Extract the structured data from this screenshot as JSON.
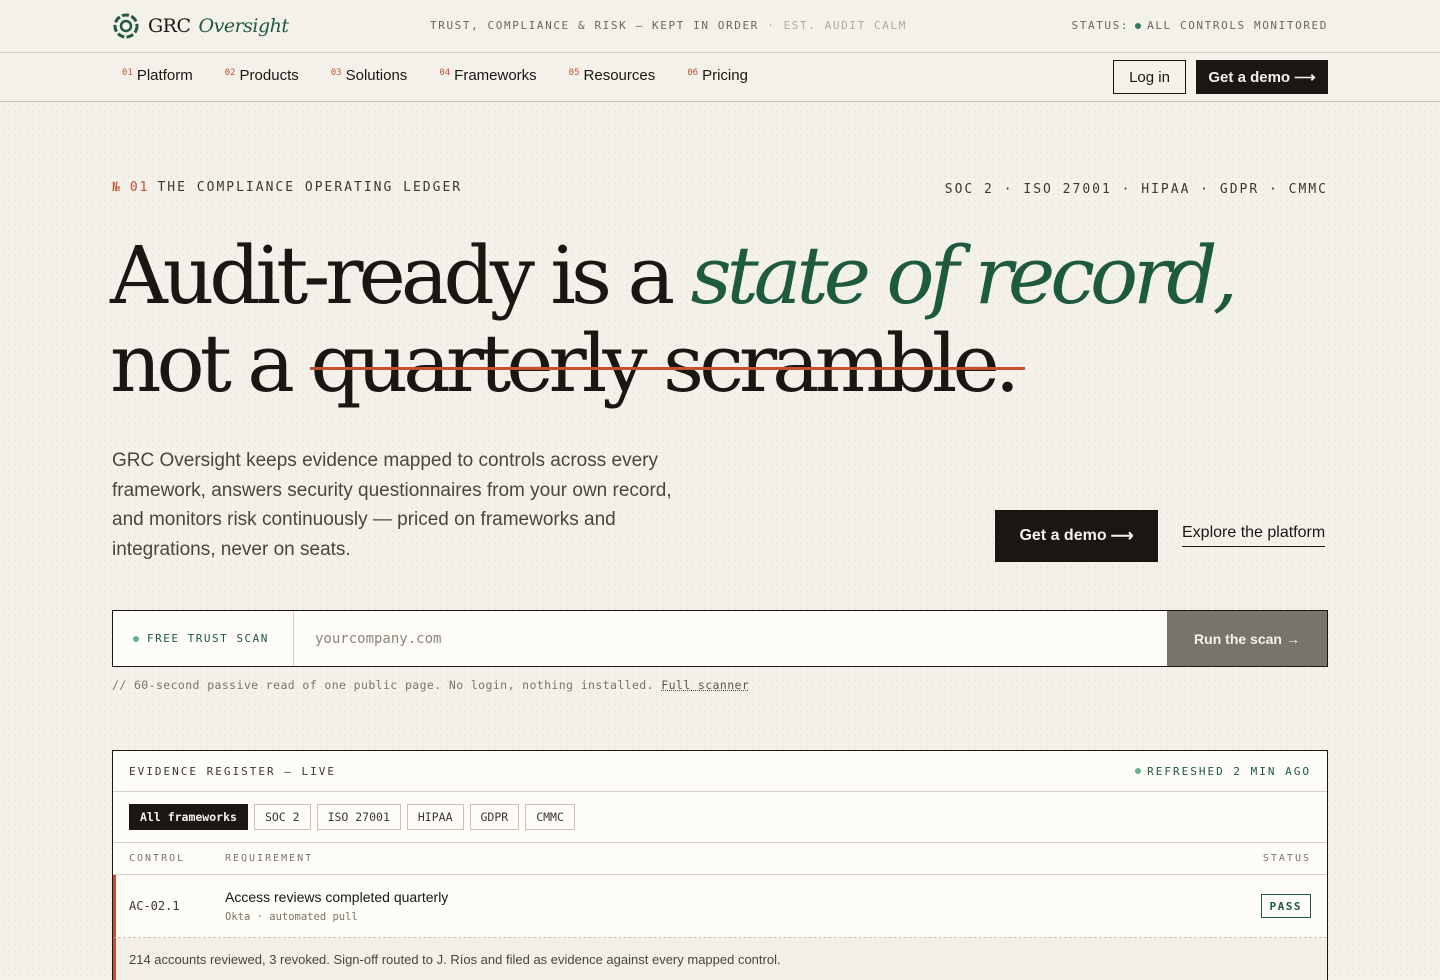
{
  "brand": {
    "name": "GRC",
    "name_accent": "Oversight"
  },
  "topbar": {
    "tagline": "TRUST, COMPLIANCE & RISK — KEPT IN ORDER",
    "tagline_faint": "· EST. AUDIT CALM",
    "status_prefix": "STATUS:",
    "status_text": "ALL CONTROLS MONITORED"
  },
  "nav": {
    "items": [
      {
        "num": "01",
        "label": "Platform"
      },
      {
        "num": "02",
        "label": "Products"
      },
      {
        "num": "03",
        "label": "Solutions"
      },
      {
        "num": "04",
        "label": "Frameworks"
      },
      {
        "num": "05",
        "label": "Resources"
      },
      {
        "num": "06",
        "label": "Pricing"
      }
    ],
    "login": "Log in",
    "demo": "Get a demo"
  },
  "hero": {
    "eyebrow_symbol": "№",
    "eyebrow_num": "01",
    "eyebrow_text": "THE COMPLIANCE OPERATING LEDGER",
    "frameworks": "SOC 2 · ISO 27001 · HIPAA · GDPR · CMMC",
    "headline_1": "Audit-ready is a ",
    "headline_1_accent": "state of record,",
    "headline_2": "not a ",
    "headline_2_strike": "quarterly scramble.",
    "lead": "GRC Oversight keeps evidence mapped to controls across every framework, answers security questionnaires from your own record, and monitors risk continuously — priced on frameworks and integrations, never on seats.",
    "cta_primary": "Get a demo",
    "cta_secondary": "Explore the platform"
  },
  "scan": {
    "label": "FREE TRUST SCAN",
    "placeholder": "yourcompany.com",
    "value": "",
    "button": "Run the scan",
    "note": "// 60-second passive read of one public page. No login, nothing installed.",
    "note_link": "Full scanner"
  },
  "register": {
    "title": "EVIDENCE REGISTER — LIVE",
    "refreshed": "REFRESHED 2 MIN AGO",
    "tabs": [
      "All frameworks",
      "SOC 2",
      "ISO 27001",
      "HIPAA",
      "GDPR",
      "CMMC"
    ],
    "columns": {
      "control": "CONTROL",
      "requirement": "REQUIREMENT",
      "status": "STATUS"
    },
    "rows": [
      {
        "control": "AC-02.1",
        "requirement": "Access reviews completed quarterly",
        "source": "Okta · automated pull",
        "status": "PASS",
        "detail": "214 accounts reviewed, 3 revoked. Sign-off routed to J. Ríos and filed as evidence against every mapped control."
      }
    ]
  },
  "colors": {
    "background": "#f4f1ea",
    "ink": "#1a1712",
    "accent_green": "#1e5a3c",
    "accent_rust": "#c2512e"
  }
}
